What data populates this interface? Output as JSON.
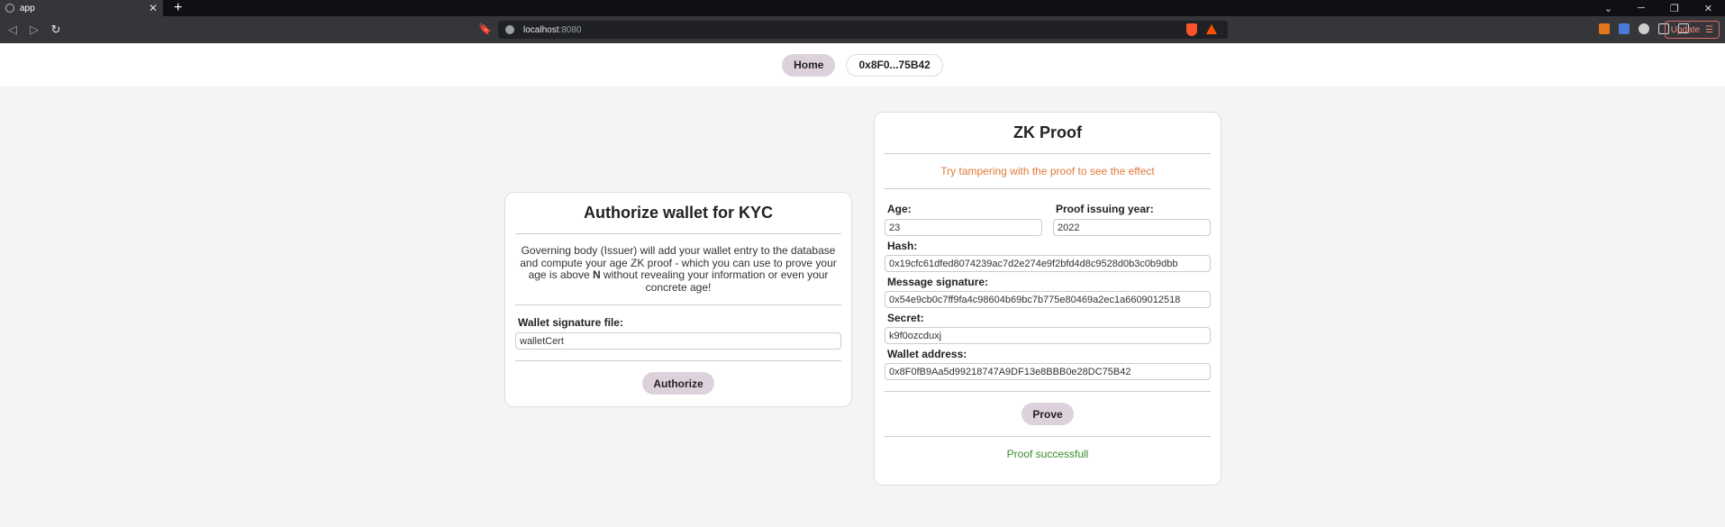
{
  "browser": {
    "tab_title": "app",
    "url_host": "localhost",
    "url_port": ":8080",
    "update_label": "Update"
  },
  "nav": {
    "home_label": "Home",
    "wallet_label": "0x8F0...75B42"
  },
  "kyc": {
    "title": "Authorize wallet for KYC",
    "desc_part1": "Governing body (Issuer) will add your wallet entry to the database and compute your age ZK proof - which you can use to prove your age is above ",
    "desc_bold": "N",
    "desc_part2": " without revealing your information or even your concrete age!",
    "file_label": "Wallet signature file:",
    "file_value": "walletCert",
    "authorize_label": "Authorize"
  },
  "proof": {
    "title": "ZK Proof",
    "hint": "Try tampering with the proof to see the effect",
    "age_label": "Age:",
    "age_value": "23",
    "year_label": "Proof issuing year:",
    "year_value": "2022",
    "hash_label": "Hash:",
    "hash_value": "0x19cfc61dfed8074239ac7d2e274e9f2bfd4d8c9528d0b3c0b9dbb",
    "sig_label": "Message signature:",
    "sig_value": "0x54e9cb0c7ff9fa4c98604b69bc7b775e80469a2ec1a6609012518",
    "secret_label": "Secret:",
    "secret_value": "k9f0ozcduxj",
    "wallet_label": "Wallet address:",
    "wallet_value": "0x8F0fB9Aa5d99218747A9DF13e8BBB0e28DC75B42",
    "prove_label": "Prove",
    "status": "Proof successfull"
  }
}
